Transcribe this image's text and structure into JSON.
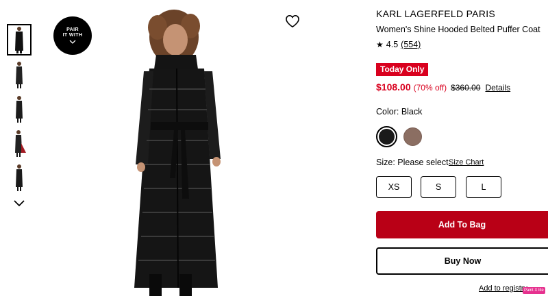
{
  "thumbnails": [
    {
      "label": "thumb-1",
      "active": true
    },
    {
      "label": "thumb-2",
      "active": false
    },
    {
      "label": "thumb-3",
      "active": false
    },
    {
      "label": "thumb-4",
      "active": false
    },
    {
      "label": "thumb-5",
      "active": false
    }
  ],
  "pair_badge": {
    "line1": "PAIR",
    "line2": "IT WITH"
  },
  "product": {
    "brand": "KARL LAGERFELD PARIS",
    "name": "Women's Shine Hooded Belted Puffer Coat",
    "rating": "4.5",
    "review_count": "(554)",
    "badge": "Today Only",
    "sale_price": "$108.00",
    "discount": "(70% off)",
    "original_price": "$360.00",
    "details_link": "Details",
    "color_label": "Color: Black",
    "colors": [
      {
        "name": "Black",
        "hex": "#1a1a1a",
        "selected": true
      },
      {
        "name": "Brown",
        "hex": "#8b6e62",
        "selected": false
      }
    ],
    "size_label": "Size: Please select",
    "size_chart_link": "Size Chart",
    "sizes": [
      "XS",
      "S",
      "L"
    ],
    "add_to_bag": "Add To Bag",
    "buy_now": "Buy Now",
    "registry_link": "Add to registry"
  },
  "overlay_badge": "Paint X lite",
  "icons": {
    "heart": "heart-outline-icon",
    "thumb_down": "chevron-down-icon",
    "badge_chevron": "chevron-down-icon",
    "star": "star-icon"
  },
  "colors": {
    "accent_red": "#d9001e",
    "button_red": "#b90016"
  }
}
